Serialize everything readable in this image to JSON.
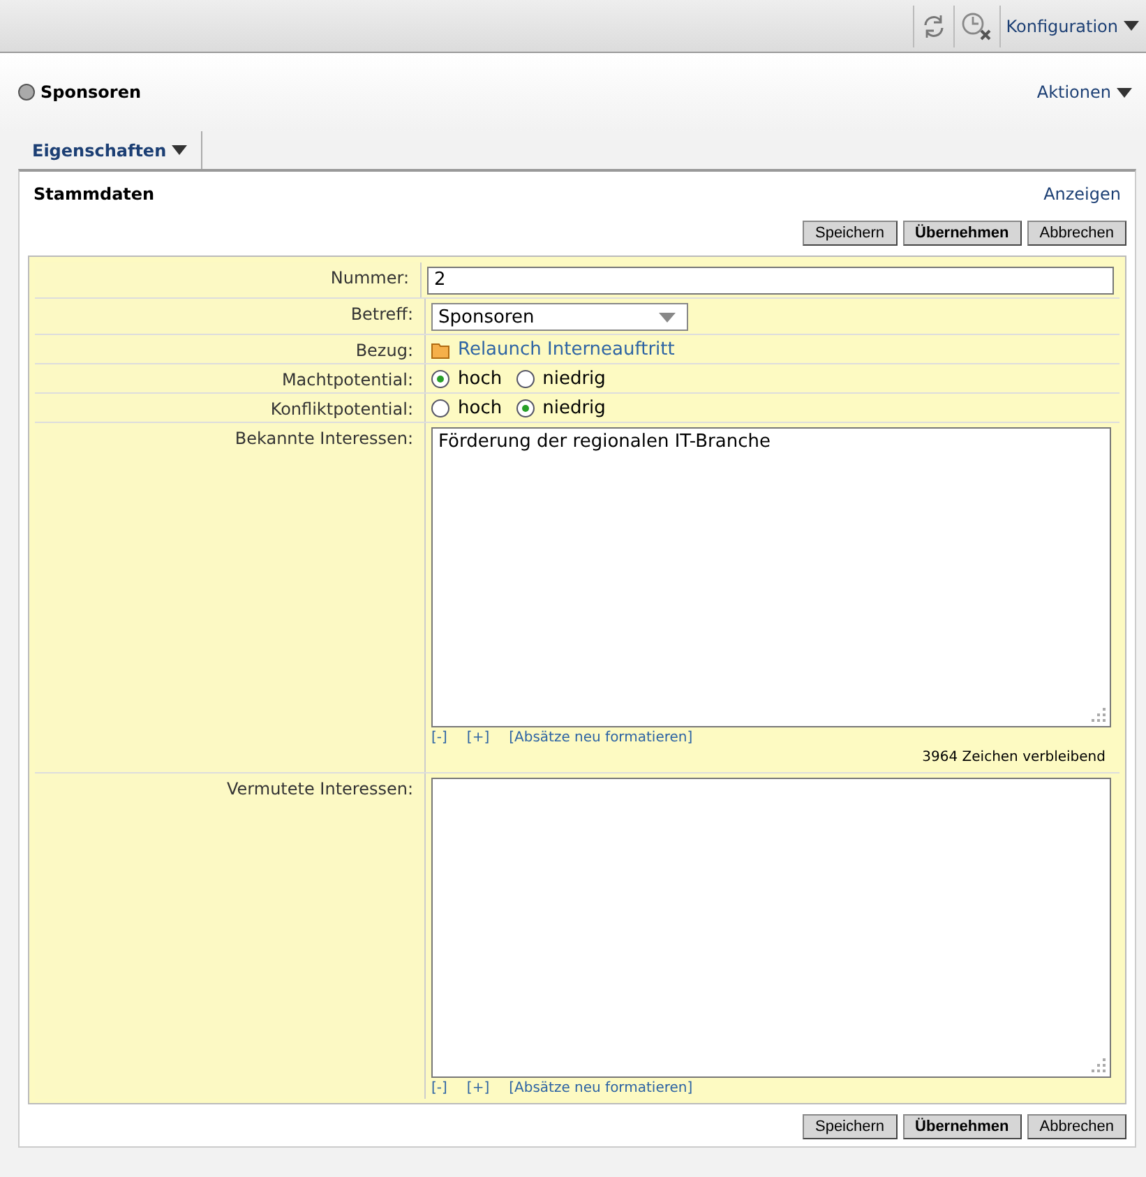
{
  "toolbar": {
    "menu": "Konfiguration"
  },
  "header": {
    "title": "Sponsoren",
    "actions": "Aktionen"
  },
  "tabs": [
    {
      "label": "Eigenschaften",
      "selected": true
    }
  ],
  "section": {
    "title": "Stammdaten",
    "link": "Anzeigen"
  },
  "buttons_top": [
    {
      "label": "Speichern",
      "kind": "normal"
    },
    {
      "label": "Übernehmen",
      "kind": "primary"
    },
    {
      "label": "Abbrechen",
      "kind": "normal"
    }
  ],
  "fields": [
    {
      "kind": "text",
      "label": "Nummer:",
      "value": "2"
    },
    {
      "kind": "select",
      "label": "Betreff:",
      "value": "Sponsoren"
    },
    {
      "kind": "link",
      "label": "Bezug:",
      "value": "Relaunch Interneauftritt"
    },
    {
      "kind": "radio",
      "label": "Machtpotential:",
      "options": [
        {
          "label": "hoch",
          "selected": true
        },
        {
          "label": "niedrig",
          "selected": false
        }
      ]
    },
    {
      "kind": "radio",
      "label": "Konfliktpotential:",
      "options": [
        {
          "label": "hoch",
          "selected": false
        },
        {
          "label": "niedrig",
          "selected": true
        }
      ]
    },
    {
      "kind": "textarea",
      "label": "Bekannte Interessen:",
      "value": "Förderung der regionalen IT-Branche",
      "tools": [
        "[-]",
        "[+]",
        "[Absätze neu formatieren]"
      ],
      "counter": "3964 Zeichen verbleibend"
    },
    {
      "kind": "textarea",
      "label": "Vermutete Interessen:",
      "tools": [
        "[-]",
        "[+]",
        "[Absätze neu formatieren]"
      ]
    }
  ],
  "buttons_bottom": [
    {
      "label": "Speichern",
      "kind": "normal"
    },
    {
      "label": "Übernehmen",
      "kind": "primary"
    },
    {
      "label": "Abbrechen",
      "kind": "normal"
    }
  ]
}
